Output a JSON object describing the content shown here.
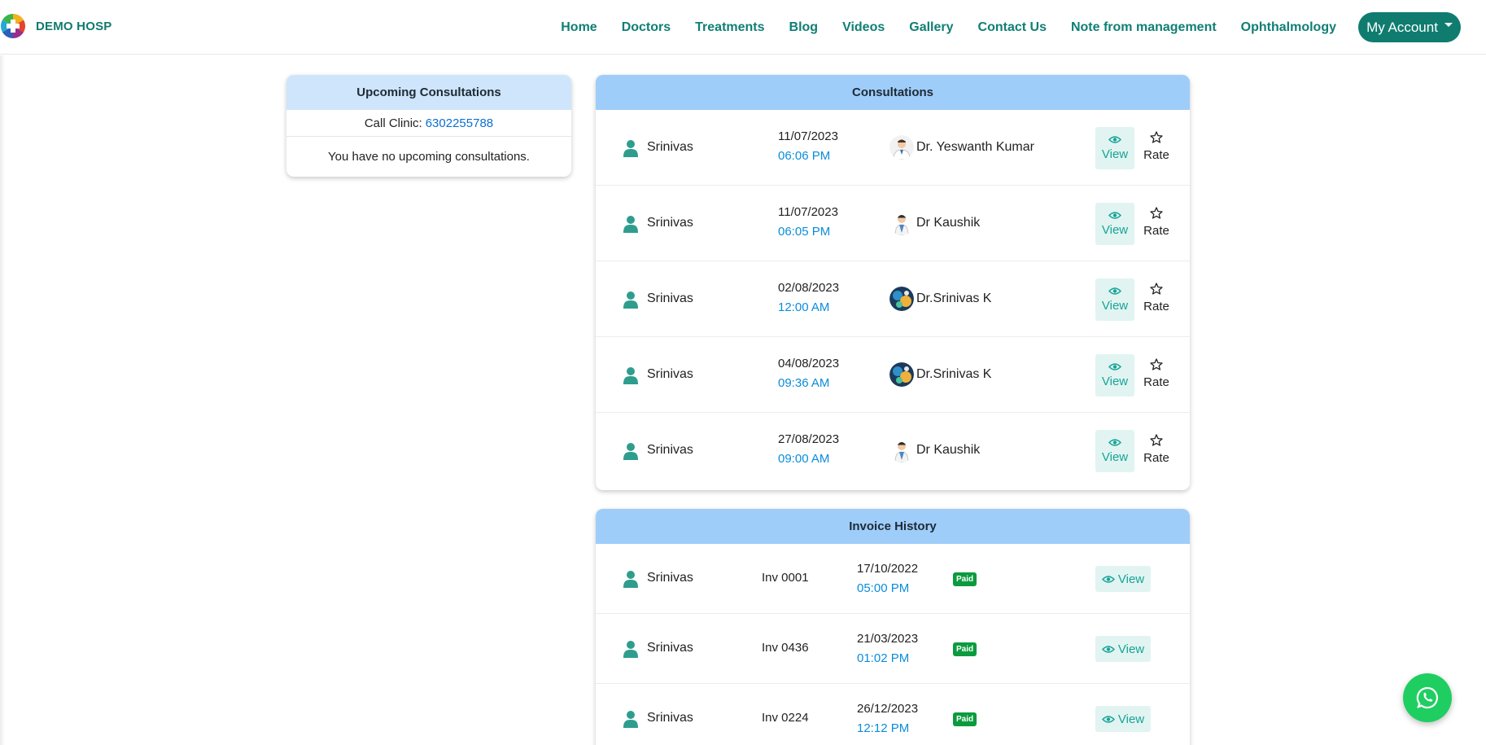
{
  "brand": {
    "name": "DEMO HOSP"
  },
  "nav": {
    "links": [
      "Home",
      "Doctors",
      "Treatments",
      "Blog",
      "Videos",
      "Gallery",
      "Contact Us",
      "Note from management",
      "Ophthalmology"
    ],
    "account_label": "My Account"
  },
  "upcoming": {
    "title": "Upcoming Consultations",
    "call_label": "Call Clinic:",
    "phone": "6302255788",
    "empty_text": "You have no upcoming consultations."
  },
  "consultations": {
    "title": "Consultations",
    "view_label": "View",
    "rate_label": "Rate",
    "rows": [
      {
        "patient": "Srinivas",
        "date": "11/07/2023",
        "time": "06:06 PM",
        "doctor": "Dr. Yeswanth Kumar",
        "avatar": "doctor-avatar"
      },
      {
        "patient": "Srinivas",
        "date": "11/07/2023",
        "time": "06:05 PM",
        "doctor": "Dr Kaushik",
        "avatar": "doctor-avatar"
      },
      {
        "patient": "Srinivas",
        "date": "02/08/2023",
        "time": "12:00 AM",
        "doctor": "Dr.Srinivas K",
        "avatar": "photo-avatar"
      },
      {
        "patient": "Srinivas",
        "date": "04/08/2023",
        "time": "09:36 AM",
        "doctor": "Dr.Srinivas K",
        "avatar": "photo-avatar"
      },
      {
        "patient": "Srinivas",
        "date": "27/08/2023",
        "time": "09:00 AM",
        "doctor": "Dr Kaushik",
        "avatar": "doctor-avatar"
      }
    ]
  },
  "invoices": {
    "title": "Invoice History",
    "view_label": "View",
    "rows": [
      {
        "patient": "Srinivas",
        "invoice": "Inv 0001",
        "date": "17/10/2022",
        "time": "05:00 PM",
        "status": "Paid"
      },
      {
        "patient": "Srinivas",
        "invoice": "Inv 0436",
        "date": "21/03/2023",
        "time": "01:02 PM",
        "status": "Paid"
      },
      {
        "patient": "Srinivas",
        "invoice": "Inv 0224",
        "date": "26/12/2023",
        "time": "12:12 PM",
        "status": "Paid"
      }
    ]
  },
  "colors": {
    "brand_teal": "#0f7c6f",
    "card_header_blue": "#9fcdf9",
    "time_blue": "#0a8ddb",
    "paid_green": "#0b9b3e",
    "whatsapp_green": "#1fce61"
  },
  "icons": [
    "logo-icon",
    "person-icon",
    "eye-icon",
    "star-icon",
    "whatsapp-icon"
  ]
}
